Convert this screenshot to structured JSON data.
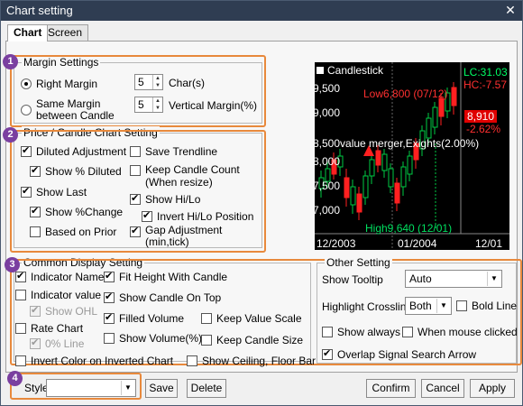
{
  "window": {
    "title": "Chart setting",
    "close_label": "✕"
  },
  "tabs": [
    {
      "label": "Chart"
    },
    {
      "label": "Screen"
    }
  ],
  "badges": [
    "1",
    "2",
    "3",
    "4"
  ],
  "margin": {
    "title": "Margin Settings",
    "right_margin_label": "Right Margin",
    "same_margin_label_1": "Same Margin",
    "same_margin_label_2": "between Candle",
    "chars_value": "5",
    "chars_unit": "Char(s)",
    "vmargin_value": "5",
    "vmargin_unit": "Vertical Margin(%)"
  },
  "price": {
    "title": "Price / Candle Chart Setting",
    "diluted": "Diluted Adjustment",
    "show_pct_diluted": "Show % Diluted",
    "show_last": "Show Last",
    "show_pct_change": "Show %Change",
    "based_on_prior": "Based on Prior",
    "save_trendline": "Save Trendline",
    "keep_candle_1": "Keep Candle Count",
    "keep_candle_2": "(When resize)",
    "show_hilo": "Show Hi/Lo",
    "invert_hilo": "Invert Hi/Lo Position",
    "gap_1": "Gap Adjustment",
    "gap_2": "(min,tick)"
  },
  "common": {
    "title": "Common Display Setting",
    "indicator_name": "Indicator Name",
    "indicator_value": "Indicator value",
    "show_ohl": "Show OHL",
    "rate_chart": "Rate Chart",
    "zero_line": "0% Line",
    "invert_color": "Invert Color on Inverted Chart",
    "fit_height": "Fit Height With Candle",
    "show_candle_top": "Show Candle On Top",
    "filled_volume": "Filled Volume",
    "show_volume_pct": "Show Volume(%)",
    "show_ceiling": "Show Ceiling, Floor Bar",
    "keep_value_scale": "Keep Value Scale",
    "keep_candle_size": "Keep Candle Size"
  },
  "other": {
    "title": "Other Setting",
    "tooltip_label": "Show Tooltip",
    "tooltip_value": "Auto",
    "highlight_label": "Highlight Crossline",
    "highlight_value": "Both",
    "bold_line": "Bold Line",
    "show_always": "Show always",
    "when_mouse": "When mouse clicked",
    "overlap": "Overlap Signal Search Arrow"
  },
  "chart_preview": {
    "legend": "Candlestick",
    "y_ticks": [
      "9,500",
      "9,000",
      "8,500",
      "8,000",
      "7,500",
      "7,000"
    ],
    "x_ticks": [
      "12/2003",
      "01/2004",
      "12/01"
    ],
    "low_label": "Low6,800 (07/12)",
    "high_label": "High9,640 (12/01)",
    "annotation": "value merger,Exights(2.00%)",
    "lc_label": "LC:31.03",
    "hc_label": "HC:-7.57",
    "price_tag": "8,910",
    "pct_tag": "-2.62%",
    "colors": {
      "up": "#00cc44",
      "down": "#ff2020",
      "tag_bg": "#e00000",
      "lc": "#00ff66"
    }
  },
  "footer": {
    "style_label": "Style",
    "style_value": "",
    "save": "Save",
    "delete": "Delete",
    "confirm": "Confirm",
    "cancel": "Cancel",
    "apply": "Apply"
  }
}
